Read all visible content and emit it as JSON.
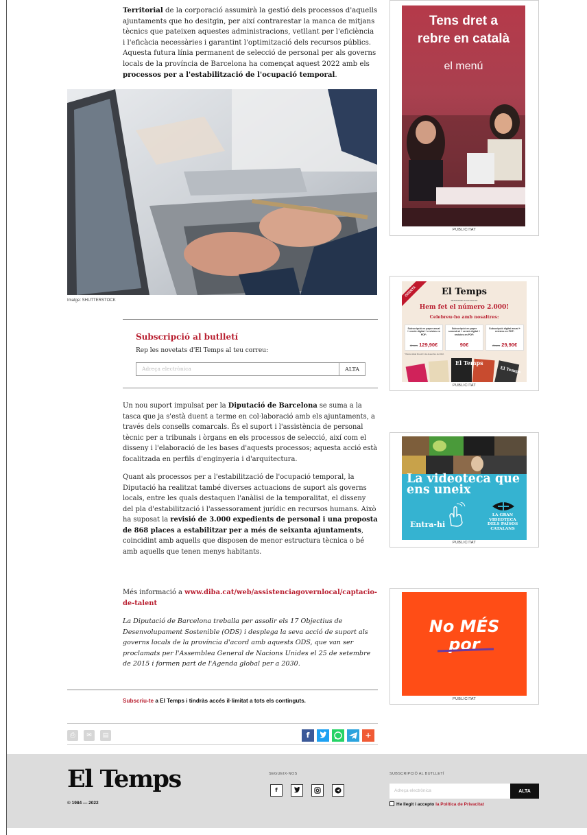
{
  "article": {
    "intro_html_parts": {
      "b1": "Territorial",
      "t1": " de la corporació assumirà la gestió dels processos d'aquells ajuntaments que ho desitgin, per així contrarestar la manca de mitjans tècnics que pateixen aquestes administracions, vetllant per l'eficiència i l'eficàcia necessàries i garantint l'optimització dels recursos públics. Aquesta futura línia permanent de selecció de personal per als governs locals de la província de Barcelona ha començat aquest 2022 amb els ",
      "b2": "processos per a l'estabilització de l'ocupació temporal",
      "t2": "."
    },
    "image_credit": "Imatge: SHUTTERSTOCK",
    "p1": {
      "t1": "Un nou suport impulsat per la ",
      "b1": "Diputació de Barcelona",
      "t2": " se suma a la tasca que ja s'està duent a terme en col·laboració amb els ajuntaments, a través dels consells comarcals. És el suport i l'assistència de personal tècnic per a tribunals i òrgans en els processos de selecció, així com el disseny i l'elaboració de les bases d'aquests processos; aquesta acció està focalitzada en perfils d'enginyeria i d'arquitectura."
    },
    "p2": {
      "t1": "Quant als processos per a l'estabilització de l'ocupació temporal, la Diputació ha realitzat també diverses actuacions de suport als governs locals, entre les quals destaquen l'anàlisi de la temporalitat, el disseny del pla d'estabilització i l'assessorament jurídic en recursos humans. Això ha suposat la ",
      "b1": "revisió de 3.000 expedients de personal i una proposta de 868 places a estabilitzar per a més de seixanta ajuntaments",
      "t2": ", coincidint amb aquells que disposen de menor estructura tècnica o bé amb aquells que tenen menys habitants."
    },
    "more_prefix": "Més informació a ",
    "more_link": "www.diba.cat/web/assistenciagovernlocal/captacio-de-talent",
    "ods": "La Diputació de Barcelona treballa per assolir els 17 Objectius de Desenvolupament Sostenible (ODS) i desplega la seva acció de suport als governs locals de la província d'acord amb aquests ODS, que van ser proclamats per l'Assemblea General de Nacions Unides el 25 de setembre de 2015 i formen part de l'Agenda global per a 2030.",
    "subscribe_link": "Subscriu-te",
    "subscribe_rest": " a El Temps i tindràs accés il·limitat a tots els continguts."
  },
  "newsletter": {
    "title": "Subscripció al butlletí",
    "subtitle": "Rep les novetats d'El Temps al teu correu:",
    "placeholder": "Adreça electrònica",
    "button": "ALTA"
  },
  "tools": {
    "icons": [
      "print-icon",
      "mail-icon",
      "pdf-icon"
    ],
    "share": [
      {
        "name": "facebook-icon",
        "glyph": "f",
        "color": "#3b5998"
      },
      {
        "name": "twitter-icon",
        "glyph": "t",
        "color": "#1da1f2"
      },
      {
        "name": "whatsapp-icon",
        "glyph": "w",
        "color": "#25d366"
      },
      {
        "name": "telegram-icon",
        "glyph": "➤",
        "color": "#2aa3dd"
      },
      {
        "name": "more-share-icon",
        "glyph": "+",
        "color": "#f05a35"
      }
    ]
  },
  "ads": {
    "label": "PUBLICITAT",
    "ad1": {
      "line1": "Tens dret a",
      "line2": "rebre en català",
      "line3": "el menú"
    },
    "ad2": {
      "ribbon": "OFERTA",
      "brand": "El Temps",
      "small": "SETMANARI D'ACTUALITAT",
      "headline": "Hem fet el número 2.000!",
      "sub": "Celebreu-ho amb nosaltres:",
      "offers": [
        {
          "text": "Subscripció en paper anual + versió digital + revistes en PDF:",
          "old": "Abans",
          "price": "129,90€"
        },
        {
          "text": "Subscripció en paper semestral + versió digital + revistes en PDF:",
          "old": "",
          "price": "90€"
        },
        {
          "text": "Subscripció digital anual + revistes en PDF:",
          "old": "Abans",
          "price": "29,90€"
        }
      ],
      "foot": "*Oferta vàlida fins al 31 de desembre de 2022."
    },
    "ad3": {
      "headline": "La videoteca que ens uneix",
      "cta": "Entra-hi",
      "side": "LA GRAN VIDEOTECA DELS PAÏSOS CATALANS"
    },
    "ad4": {
      "line1": "No MÉS",
      "line2": "por"
    }
  },
  "footer": {
    "logo": "El Temps",
    "copyright": "© 1984 — 2022",
    "follow_label": "SEGUEIX-NOS",
    "social": [
      "f",
      "t",
      "◎",
      "➤"
    ],
    "newsletter_label": "SUBSCRIPCIÓ AL BUTLLETÍ",
    "placeholder": "Adreça electrònica",
    "button": "ALTA",
    "check_text": "He llegit i accepto ",
    "check_link": "la Política de Privacitat"
  },
  "colors": {
    "accent": "#b81e2f",
    "footer_bg": "#dcdcdc"
  }
}
